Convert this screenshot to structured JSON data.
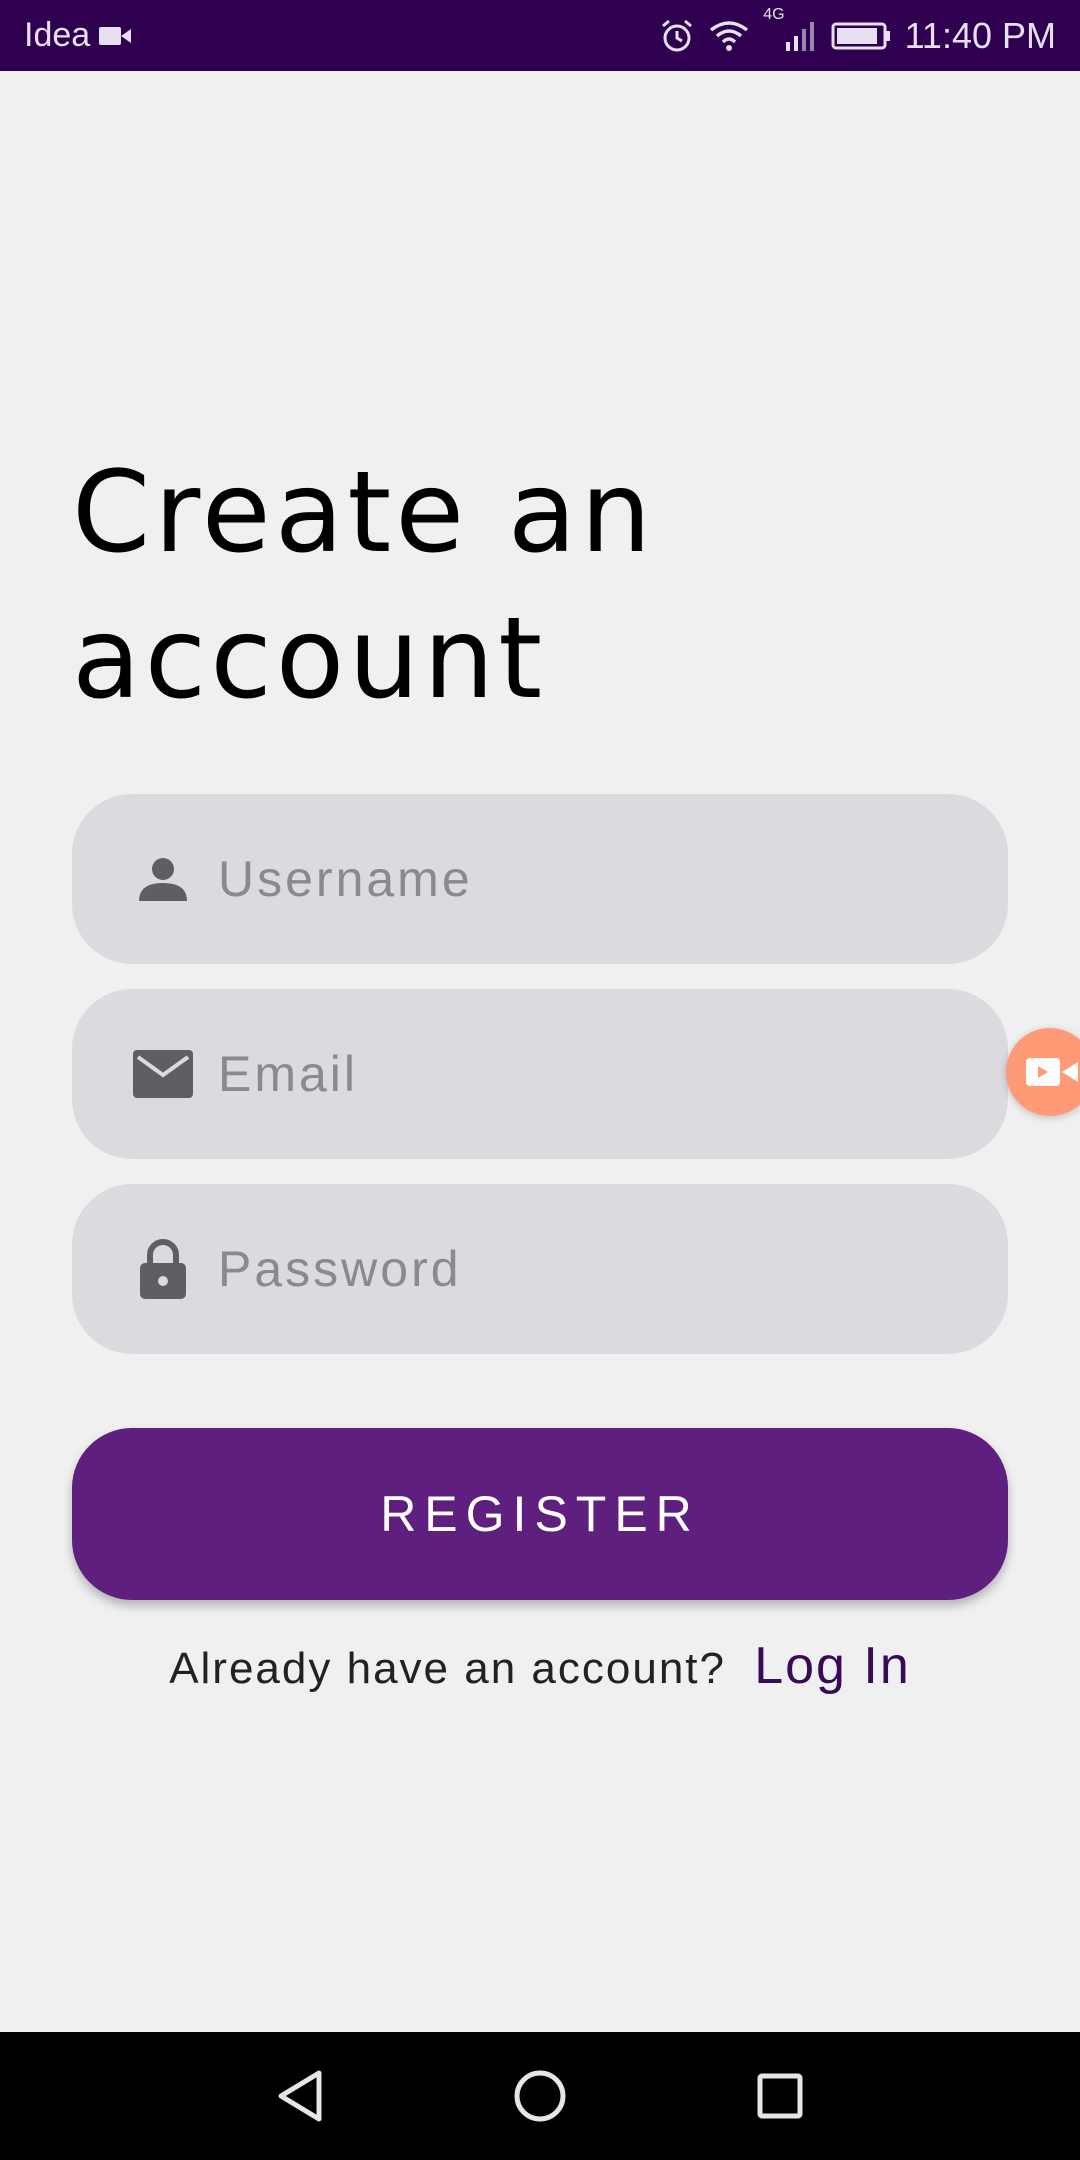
{
  "status_bar": {
    "carrier": "Idea",
    "network": "4G",
    "time": "11:40 PM"
  },
  "title": {
    "line1": "Create an",
    "line2": "account"
  },
  "form": {
    "username_placeholder": "Username",
    "email_placeholder": "Email",
    "password_placeholder": "Password",
    "register_label": "REGISTER"
  },
  "footer": {
    "prompt": "Already have an account?",
    "login_label": "Log In"
  },
  "colors": {
    "status_bar": "#2f0050",
    "accent": "#5e1f7e",
    "field_bg": "#dbdadf"
  }
}
